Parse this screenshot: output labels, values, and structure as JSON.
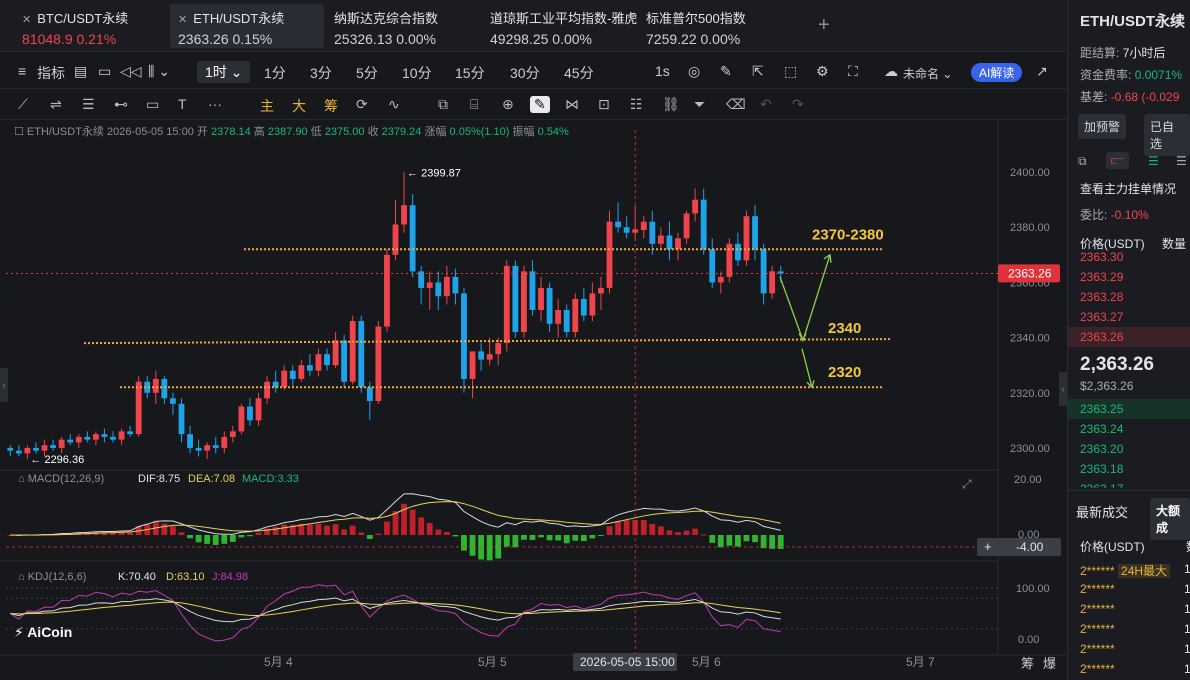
{
  "tickers": [
    {
      "name": "BTC/USDT永续",
      "price": "81048.9",
      "change": "0.21%",
      "dir": "down",
      "active": false
    },
    {
      "name": "ETH/USDT永续",
      "price": "2363.26",
      "change": "0.15%",
      "dir": "flat",
      "active": true
    },
    {
      "name": "纳斯达克综合指数",
      "price": "25326.13",
      "change": "0.00%",
      "dir": "flat",
      "active": false
    },
    {
      "name": "道琼斯工业平均指数-雅虎",
      "price": "49298.25",
      "change": "0.00%",
      "dir": "flat",
      "active": false
    },
    {
      "name": "标准普尔500指数",
      "price": "7259.22",
      "change": "0.00%",
      "dir": "flat",
      "active": false
    }
  ],
  "add_tab": "+",
  "toolbar": {
    "indicator": "指标",
    "intervals": [
      "1时",
      "1分",
      "3分",
      "5分",
      "10分",
      "15分",
      "30分",
      "45分",
      "1s"
    ],
    "selected_interval": "1时",
    "unnamed": "未命名",
    "ai": "AI解读"
  },
  "draw_tools": {
    "main": "主",
    "big": "大",
    "chip": "筹"
  },
  "ohlc": {
    "symbol": "ETH/USDT永续",
    "time": "2026-05-05 15:00",
    "open_label": "开",
    "open": "2378.14",
    "high_label": "高",
    "high": "2387.90",
    "low_label": "低",
    "low": "2375.00",
    "close_label": "收",
    "close": "2379.24",
    "change_label": "涨幅",
    "change": "0.05%(1.10)",
    "amp_label": "振幅",
    "amp": "0.54%"
  },
  "macd_legend": {
    "name": "MACD(12,26,9)",
    "dif": "DIF:8.75",
    "dea": "DEA:7.08",
    "macd": "MACD:3.33"
  },
  "kdj_legend": {
    "name": "KDJ(12,6,6)",
    "k": "K:70.40",
    "d": "D:63.10",
    "j": "J:84.98"
  },
  "price_axis": [
    "2400.00",
    "2380.00",
    "2360.00",
    "2340.00",
    "2320.00",
    "2300.00"
  ],
  "macd_axis": [
    "20.00",
    "0.00",
    "-4.00"
  ],
  "kdj_axis": [
    "100.00",
    "0.00"
  ],
  "time_axis": [
    "5月 4",
    "5月 5",
    "5月 6",
    "5月 7"
  ],
  "crosshair_time": "2026-05-05 15:00",
  "last_price_tag": "2363.26",
  "footer_labels": [
    "筹",
    "爆"
  ],
  "logo": "AiCoin",
  "colors": {
    "up": "#16b979",
    "down": "#f0444c",
    "candle_up": "#f0444c",
    "candle_down": "#1ea3ea",
    "level": "#f2a93b",
    "arrow": "#8bd14a"
  },
  "chart_data": {
    "type": "candlestick",
    "interval": "1h",
    "ylim": [
      2292,
      2408
    ],
    "candles": [
      [
        2300,
        2301,
        2297,
        2299
      ],
      [
        2299,
        2301,
        2297,
        2298
      ],
      [
        2298,
        2301,
        2296,
        2300
      ],
      [
        2300,
        2302,
        2298,
        2299
      ],
      [
        2299,
        2303,
        2297,
        2301
      ],
      [
        2301,
        2303,
        2299,
        2300
      ],
      [
        2300,
        2304,
        2298,
        2303
      ],
      [
        2303,
        2305,
        2301,
        2302
      ],
      [
        2302,
        2305,
        2300,
        2304
      ],
      [
        2304,
        2306,
        2302,
        2303
      ],
      [
        2303,
        2306,
        2301,
        2305
      ],
      [
        2305,
        2307,
        2302,
        2304
      ],
      [
        2304,
        2306,
        2302,
        2303
      ],
      [
        2303,
        2307,
        2301,
        2306
      ],
      [
        2306,
        2308,
        2304,
        2305
      ],
      [
        2305,
        2326,
        2304,
        2324
      ],
      [
        2324,
        2326,
        2318,
        2320
      ],
      [
        2320,
        2328,
        2316,
        2325
      ],
      [
        2325,
        2326,
        2316,
        2318
      ],
      [
        2318,
        2320,
        2312,
        2316
      ],
      [
        2316,
        2318,
        2302,
        2305
      ],
      [
        2305,
        2308,
        2298,
        2300
      ],
      [
        2300,
        2303,
        2297,
        2299
      ],
      [
        2299,
        2302,
        2296,
        2301
      ],
      [
        2301,
        2304,
        2298,
        2300
      ],
      [
        2300,
        2306,
        2298,
        2304
      ],
      [
        2304,
        2308,
        2302,
        2306
      ],
      [
        2306,
        2316,
        2305,
        2315
      ],
      [
        2315,
        2318,
        2308,
        2310
      ],
      [
        2310,
        2320,
        2308,
        2318
      ],
      [
        2318,
        2326,
        2316,
        2324
      ],
      [
        2324,
        2328,
        2320,
        2322
      ],
      [
        2322,
        2330,
        2321,
        2328
      ],
      [
        2328,
        2330,
        2322,
        2325
      ],
      [
        2325,
        2332,
        2324,
        2330
      ],
      [
        2330,
        2334,
        2326,
        2328
      ],
      [
        2328,
        2336,
        2326,
        2334
      ],
      [
        2334,
        2336,
        2328,
        2330
      ],
      [
        2330,
        2342,
        2329,
        2339
      ],
      [
        2339,
        2341,
        2322,
        2324
      ],
      [
        2324,
        2348,
        2323,
        2346
      ],
      [
        2346,
        2348,
        2320,
        2322
      ],
      [
        2322,
        2324,
        2310,
        2317
      ],
      [
        2317,
        2346,
        2316,
        2344
      ],
      [
        2344,
        2372,
        2342,
        2370
      ],
      [
        2370,
        2390,
        2368,
        2381
      ],
      [
        2381,
        2399.87,
        2378,
        2388
      ],
      [
        2388,
        2392,
        2362,
        2364
      ],
      [
        2364,
        2366,
        2352,
        2358
      ],
      [
        2358,
        2364,
        2350,
        2360
      ],
      [
        2360,
        2364,
        2350,
        2355
      ],
      [
        2355,
        2366,
        2352,
        2362
      ],
      [
        2362,
        2365,
        2352,
        2356
      ],
      [
        2356,
        2358,
        2320,
        2325
      ],
      [
        2325,
        2332,
        2318,
        2335
      ],
      [
        2335,
        2338,
        2328,
        2332
      ],
      [
        2332,
        2340,
        2330,
        2334
      ],
      [
        2334,
        2340,
        2330,
        2338
      ],
      [
        2338,
        2368,
        2335,
        2366
      ],
      [
        2366,
        2368,
        2340,
        2342
      ],
      [
        2342,
        2366,
        2340,
        2364
      ],
      [
        2364,
        2368,
        2348,
        2350
      ],
      [
        2350,
        2362,
        2346,
        2358
      ],
      [
        2358,
        2360,
        2342,
        2345
      ],
      [
        2345,
        2354,
        2340,
        2350
      ],
      [
        2350,
        2352,
        2340,
        2342
      ],
      [
        2342,
        2356,
        2340,
        2354
      ],
      [
        2354,
        2358,
        2346,
        2348
      ],
      [
        2348,
        2360,
        2346,
        2356
      ],
      [
        2356,
        2362,
        2350,
        2358
      ],
      [
        2358,
        2386,
        2356,
        2382
      ],
      [
        2382,
        2389,
        2378,
        2380
      ],
      [
        2380,
        2384,
        2376,
        2378
      ],
      [
        2378,
        2387.9,
        2375,
        2379.24
      ],
      [
        2379,
        2384,
        2376,
        2382
      ],
      [
        2382,
        2386,
        2370,
        2374
      ],
      [
        2374,
        2380,
        2372,
        2377
      ],
      [
        2377,
        2382,
        2368,
        2372
      ],
      [
        2372,
        2378,
        2368,
        2376
      ],
      [
        2376,
        2386,
        2374,
        2385
      ],
      [
        2385,
        2394,
        2382,
        2390
      ],
      [
        2390,
        2394,
        2370,
        2372
      ],
      [
        2372,
        2376,
        2358,
        2360
      ],
      [
        2360,
        2364,
        2356,
        2362
      ],
      [
        2362,
        2376,
        2360,
        2374
      ],
      [
        2374,
        2378,
        2366,
        2368
      ],
      [
        2368,
        2386,
        2366,
        2384
      ],
      [
        2384,
        2388,
        2368,
        2372
      ],
      [
        2372,
        2374,
        2352,
        2356
      ],
      [
        2356,
        2366,
        2354,
        2364
      ],
      [
        2364,
        2366,
        2360,
        2363.26
      ]
    ],
    "high_marker": "2399.87",
    "low_marker": "2296.36",
    "levels": [
      {
        "label": "2370-2380",
        "price": 2372
      },
      {
        "label": "2340",
        "price": 2338
      },
      {
        "label": "2320",
        "price": 2322
      }
    ]
  },
  "right_panel": {
    "title": "ETH/USDT永续",
    "settle_label": "距结算:",
    "settle_value": "7小时后",
    "funding_label": "资金费率:",
    "funding_value": "0.0071%",
    "basis_label": "基差:",
    "basis_value": "-0.68 (-0.029",
    "btn_alert": "加预警",
    "btn_fav": "已自选",
    "depth_title": "查看主力挂单情况",
    "ratio_label": "委比:",
    "ratio_value": "-0.10%",
    "col_price": "价格(USDT)",
    "col_qty": "数量",
    "asks": [
      "2363.30",
      "2363.29",
      "2363.28",
      "2363.27",
      "2363.26"
    ],
    "mid_price": "2,363.26",
    "mid_usd": "$2,363.26",
    "bids": [
      "2363.25",
      "2363.24",
      "2363.20",
      "2363.18",
      "2363.17"
    ],
    "trades_title": "最新成交",
    "trades_tab": "大额成",
    "trades_col": "价格(USDT)",
    "trades_col2": "数",
    "trades": [
      "2******",
      "2******",
      "2******",
      "2******",
      "2******",
      "2******"
    ],
    "trades_badge": "24H最大",
    "trades_qty": [
      "1",
      "1",
      "1",
      "1",
      "1",
      "1"
    ]
  }
}
